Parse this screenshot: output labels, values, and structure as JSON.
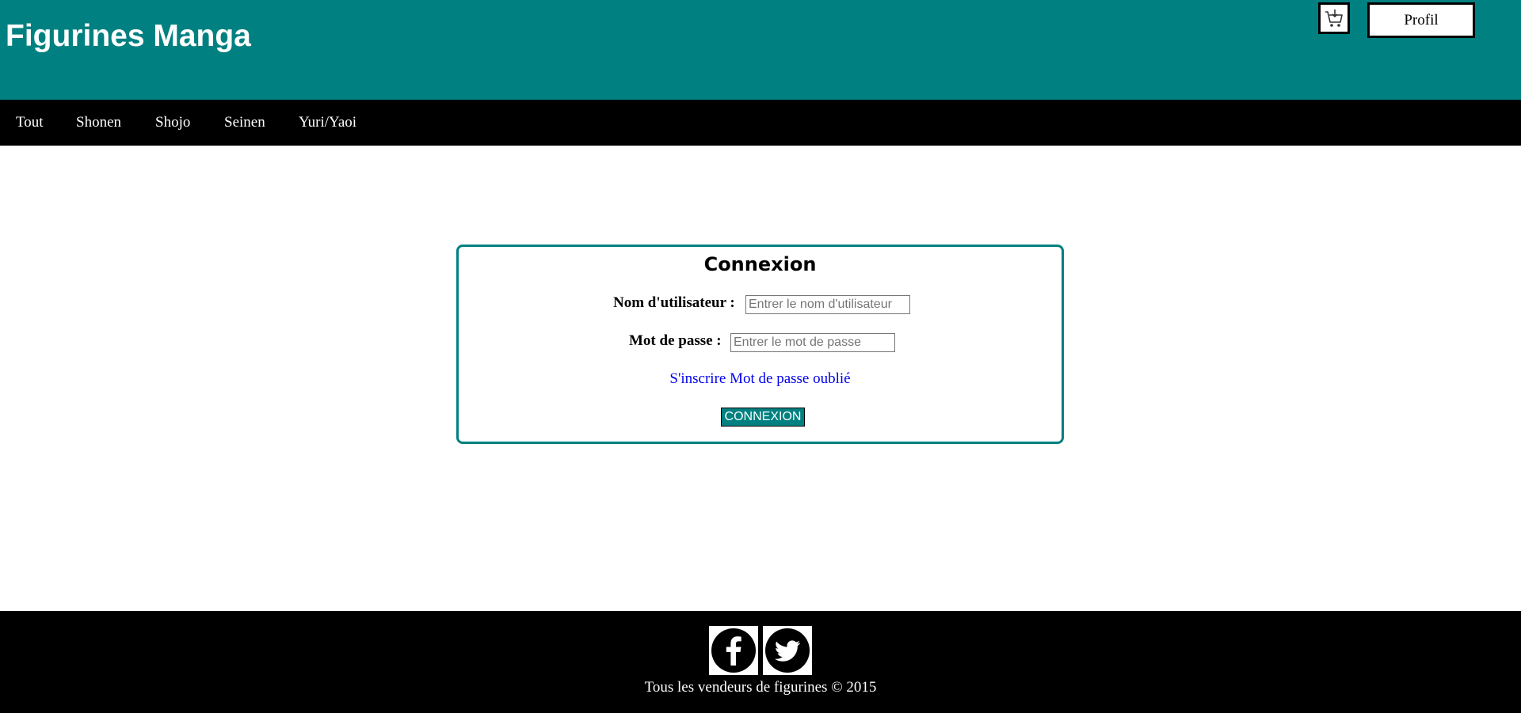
{
  "header": {
    "site_title": "Figurines Manga",
    "cart_icon": "shopping-cart-icon",
    "profile_label": "Profil",
    "background_color": "#008080"
  },
  "nav": {
    "items": [
      {
        "label": "Tout"
      },
      {
        "label": "Shonen"
      },
      {
        "label": "Shojo"
      },
      {
        "label": "Seinen"
      },
      {
        "label": "Yuri/Yaoi"
      }
    ],
    "background_color": "#000000"
  },
  "login": {
    "title": "Connexion",
    "username_label": "Nom d'utilisateur :",
    "username_value": "",
    "username_placeholder": "Entrer le nom d'utilisateur",
    "password_label": "Mot de passe :",
    "password_value": "",
    "password_placeholder": "Entrer le mot de passe",
    "signup_link": "S'inscrire",
    "forgot_link": "Mot de passe oublié",
    "submit_label": "CONNEXION",
    "accent_color": "#008080"
  },
  "footer": {
    "social_icons": [
      "facebook-icon",
      "twitter-icon"
    ],
    "copyright": "Tous les vendeurs de figurines © 2015"
  }
}
